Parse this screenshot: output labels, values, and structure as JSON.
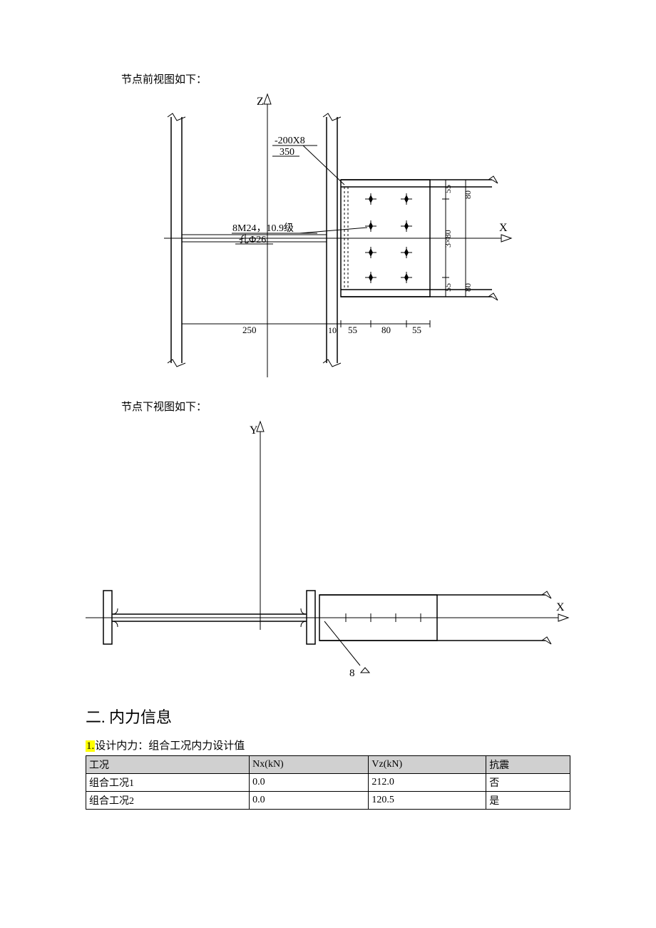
{
  "captions": {
    "front": "节点前视图如下：",
    "bottom": "节点下视图如下："
  },
  "diagram1": {
    "axis_z": "Z",
    "axis_x": "X",
    "plate_top": "-200X8",
    "plate_bot": "350",
    "bolt_top": "8M24，10.9级",
    "bolt_bot": "孔Φ26",
    "dim_left": "250",
    "dim_a": "10",
    "dim_b": "55",
    "dim_c": "80",
    "dim_d": "55",
    "dim_r_top": "80",
    "dim_r_55": "55",
    "dim_r_mid": "3×80",
    "dim_r_55b": "55",
    "dim_r_bot": "80"
  },
  "diagram2": {
    "axis_y": "Y",
    "axis_x": "X",
    "callout": "8"
  },
  "section2": {
    "heading": "二. 内力信息",
    "subnum": "1.",
    "subtext": "设计内力：组合工况内力设计值",
    "headers": [
      "工况",
      "Nx(kN)",
      "Vz(kN)",
      "抗震"
    ],
    "rows": [
      [
        "组合工况1",
        "0.0",
        "212.0",
        "否"
      ],
      [
        "组合工况2",
        "0.0",
        "120.5",
        "是"
      ]
    ]
  }
}
